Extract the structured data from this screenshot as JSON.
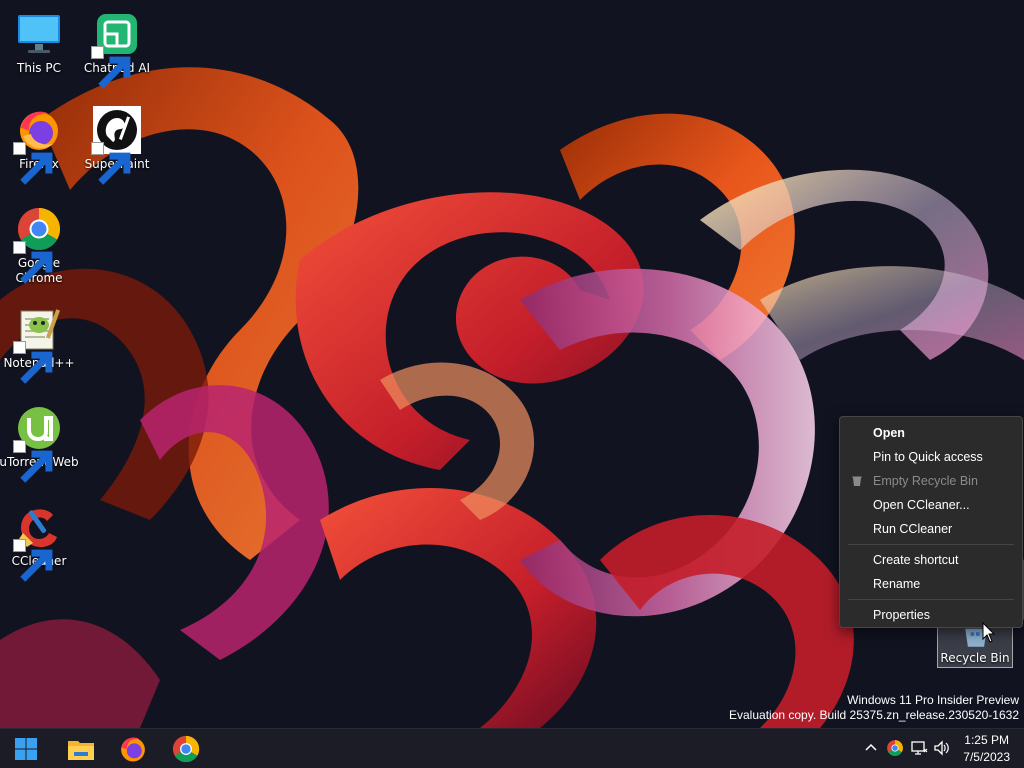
{
  "desktop": {
    "icons": [
      {
        "label": "This PC"
      },
      {
        "label": "Chatpad AI"
      },
      {
        "label": "Firefox"
      },
      {
        "label": "SuperPaint"
      },
      {
        "label": "Google Chrome"
      },
      {
        "label": "Notepad++"
      },
      {
        "label": "uTorrent Web"
      },
      {
        "label": "CCleaner"
      }
    ],
    "recycle_bin": {
      "label": "Recycle Bin"
    }
  },
  "context_menu": {
    "items": [
      {
        "label": "Open",
        "style": "bold"
      },
      {
        "label": "Pin to Quick access"
      },
      {
        "label": "Empty Recycle Bin",
        "state": "disabled"
      },
      {
        "label": "Open CCleaner..."
      },
      {
        "label": "Run CCleaner"
      },
      {
        "label": "Create shortcut"
      },
      {
        "label": "Rename"
      },
      {
        "label": "Properties"
      }
    ]
  },
  "watermark": {
    "line1": "Windows 11 Pro Insider Preview",
    "line2": "Evaluation copy. Build 25375.zn_release.230520-1632"
  },
  "taskbar": {
    "pinned": [
      "windows-start-icon",
      "file-explorer-icon",
      "firefox-icon",
      "chrome-icon"
    ],
    "tray": [
      "chevron-up-icon",
      "chrome-icon",
      "network-icon",
      "volume-icon"
    ],
    "clock": {
      "time": "1:25 PM",
      "date": "7/5/2023"
    }
  },
  "colors": {
    "background": "#111320",
    "menu_bg": "#2b2b2b",
    "taskbar_bg": "#1c1c26",
    "ribbon_orange": "#e8561c",
    "ribbon_red": "#c41e2a",
    "ribbon_pink": "#d36aa8"
  }
}
